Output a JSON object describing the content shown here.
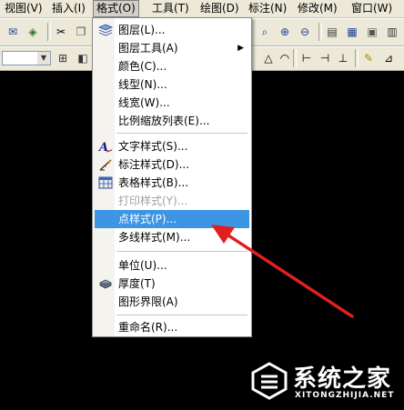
{
  "menubar": {
    "items": [
      {
        "label": "视图(V)"
      },
      {
        "label": "插入(I)"
      },
      {
        "label": "格式(O)",
        "active": true
      },
      {
        "label": "工具(T)"
      },
      {
        "label": "绘图(D)"
      },
      {
        "label": "标注(N)"
      },
      {
        "label": "修改(M)"
      },
      {
        "label": "窗口(W)"
      }
    ]
  },
  "format_menu": {
    "items": [
      {
        "label": "图层(L)...",
        "icon": "layers-icon"
      },
      {
        "label": "图层工具(A)",
        "icon": "",
        "submenu": true
      },
      {
        "label": "颜色(C)...",
        "icon": ""
      },
      {
        "label": "线型(N)...",
        "icon": ""
      },
      {
        "label": "线宽(W)...",
        "icon": ""
      },
      {
        "label": "比例缩放列表(E)...",
        "icon": ""
      },
      {
        "label": "文字样式(S)...",
        "icon": "text-style-icon"
      },
      {
        "label": "标注样式(D)...",
        "icon": "dimension-style-icon"
      },
      {
        "label": "表格样式(B)...",
        "icon": "table-style-icon"
      },
      {
        "label": "打印样式(Y)...",
        "icon": "",
        "disabled": true
      },
      {
        "label": "点样式(P)...",
        "icon": "",
        "highlighted": true
      },
      {
        "label": "多线样式(M)...",
        "icon": ""
      },
      {
        "label": "单位(U)...",
        "icon": ""
      },
      {
        "label": "厚度(T)",
        "icon": "thickness-icon"
      },
      {
        "label": "图形界限(A)",
        "icon": ""
      },
      {
        "label": "重命名(R)...",
        "icon": ""
      }
    ]
  },
  "annotation": {
    "arrow_color": "#e02020"
  },
  "watermark": {
    "title": "系统之家",
    "url": "XITONGZHIJIA.NET"
  },
  "colors": {
    "highlight": "#3d95e4",
    "menubar_bg": "#ece9d8",
    "canvas_bg": "#000000"
  }
}
